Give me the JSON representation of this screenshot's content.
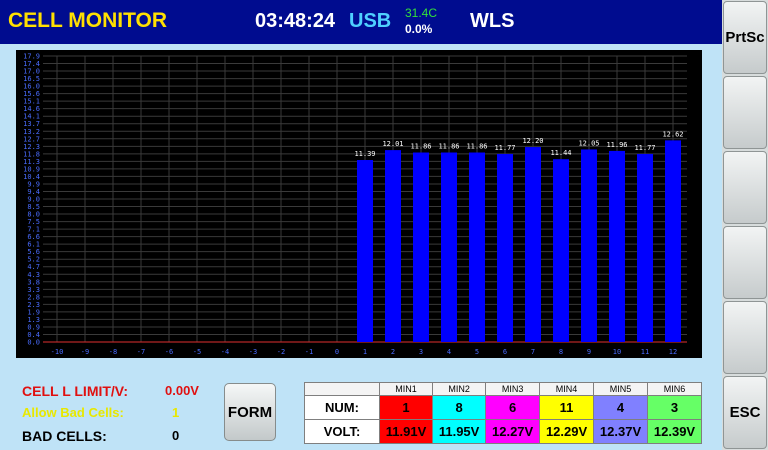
{
  "header": {
    "title": "CELL MONITOR",
    "time": "03:48:24",
    "connection": "USB",
    "temperature": "31.4C",
    "percent": "0.0%",
    "wls": "WLS"
  },
  "sidebar": {
    "prtsc_label": "PrtSc",
    "esc_label": "ESC"
  },
  "info": {
    "cell_limit_label": "CELL L LIMIT/V:",
    "cell_limit_value": "0.00V",
    "allow_bad_label": "Allow Bad Cells:",
    "allow_bad_value": "1",
    "bad_cells_label": "BAD CELLS:",
    "bad_cells_value": "0"
  },
  "form_button": "FORM",
  "min_table": {
    "row_num_label": "NUM:",
    "row_volt_label": "VOLT:",
    "headers": [
      "MIN1",
      "MIN2",
      "MIN3",
      "MIN4",
      "MIN5",
      "MIN6"
    ],
    "nums": [
      "1",
      "8",
      "6",
      "11",
      "4",
      "3"
    ],
    "volts": [
      "11.91V",
      "11.95V",
      "12.27V",
      "12.29V",
      "12.37V",
      "12.39V"
    ],
    "colors": [
      "#ff0000",
      "#00ffff",
      "#ff00ff",
      "#ffff00",
      "#8080ff",
      "#66ff66"
    ]
  },
  "colors": {
    "header_bg": "#000c8f",
    "title": "#ffe000",
    "usb": "#4fd0ff",
    "temperature": "#32e03a",
    "bar": "#0000ff",
    "grid": "#3a3a3a",
    "axis_text": "#4a6cff",
    "page_bg": "#bfe3f7",
    "limit_text": "#e01010",
    "allow_text": "#e8e800"
  },
  "chart_data": {
    "type": "bar",
    "x_ticks": [
      "-10",
      "-9",
      "-8",
      "-7",
      "-6",
      "-5",
      "-4",
      "-3",
      "-2",
      "-1",
      "0",
      "1",
      "2",
      "3",
      "4",
      "5",
      "6",
      "7",
      "8",
      "9",
      "10",
      "11",
      "12"
    ],
    "categories": [
      "1",
      "2",
      "3",
      "4",
      "5",
      "6",
      "7",
      "8",
      "9",
      "10",
      "11",
      "12"
    ],
    "values": [
      11.39,
      12.01,
      11.86,
      11.86,
      11.86,
      11.77,
      12.2,
      11.44,
      12.05,
      11.96,
      11.77,
      12.62
    ],
    "value_labels": [
      "11.39",
      "12.01",
      "11.86",
      "11.86",
      "11.86",
      "11.77",
      "12.20",
      "11.44",
      "12.05",
      "11.96",
      "11.77",
      "12.62"
    ],
    "y_ticks": [
      "0.0",
      "0.4",
      "0.9",
      "1.3",
      "1.9",
      "2.3",
      "2.8",
      "3.3",
      "3.8",
      "4.3",
      "4.7",
      "5.2",
      "5.6",
      "6.1",
      "6.6",
      "7.1",
      "7.5",
      "8.0",
      "8.5",
      "9.0",
      "9.4",
      "9.9",
      "10.4",
      "10.9",
      "11.3",
      "11.8",
      "12.3",
      "12.7",
      "13.2",
      "13.7",
      "14.1",
      "14.6",
      "15.1",
      "15.6",
      "16.0",
      "16.5",
      "17.0",
      "17.4",
      "17.9"
    ],
    "ylim": [
      0,
      17.9
    ],
    "xlim": [
      -10.5,
      12.5
    ],
    "grid": true,
    "title": "",
    "xlabel": "",
    "ylabel": ""
  }
}
